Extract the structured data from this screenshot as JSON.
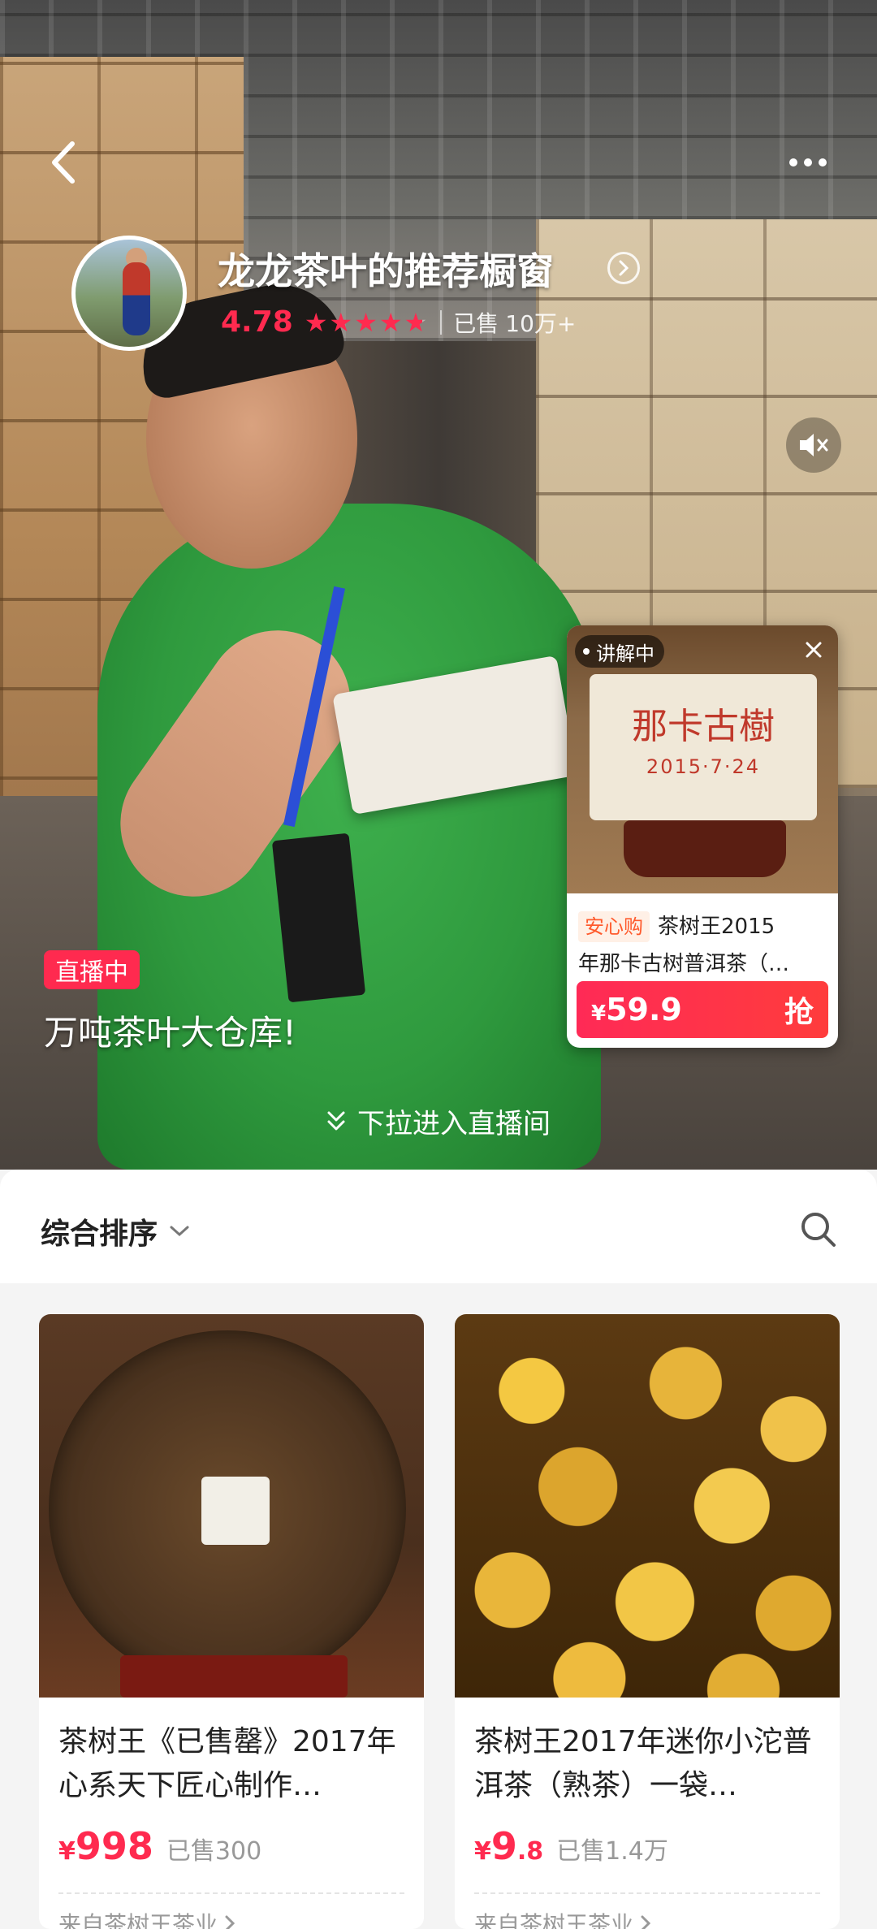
{
  "shop": {
    "name": "龙龙茶叶的推荐橱窗",
    "rating": "4.78",
    "stars_count": 4.78,
    "sold_label": "已售",
    "sold_value": "10万+"
  },
  "live": {
    "badge": "直播中",
    "title": "万吨茶叶大仓库!",
    "pull_hint": "下拉进入直播间"
  },
  "float_card": {
    "status": "讲解中",
    "tag": "安心购",
    "title_line1": "茶树王2015",
    "title_line2": "年那卡古树普洱茶（…",
    "brick_text": "那卡古樹",
    "brick_date": "2015·7·24",
    "price_symbol": "¥",
    "price": "59.9",
    "buy_label": "抢"
  },
  "sort": {
    "label": "综合排序"
  },
  "products": [
    {
      "title": "茶树王《已售罄》2017年心系天下匠心制作…",
      "yen": "¥",
      "price_int": "998",
      "price_dec": "",
      "sold": "已售300",
      "source": "来自茶树王茶业"
    },
    {
      "title": "茶树王2017年迷你小沱普洱茶（熟茶）一袋…",
      "yen": "¥",
      "price_int": "9",
      "price_dec": ".8",
      "sold": "已售1.4万",
      "source": "来自茶树王茶业"
    }
  ],
  "icons": {
    "back": "chevron-left-icon",
    "more": "more-dots-icon",
    "mute": "speaker-mute-icon",
    "close": "close-icon",
    "search": "search-icon",
    "dropdown": "chevron-down-icon",
    "pull": "double-chevron-down-icon"
  },
  "colors": {
    "accent": "#ff2a4f",
    "tag_text": "#ff5a2c",
    "tag_bg": "#fff0e6"
  }
}
